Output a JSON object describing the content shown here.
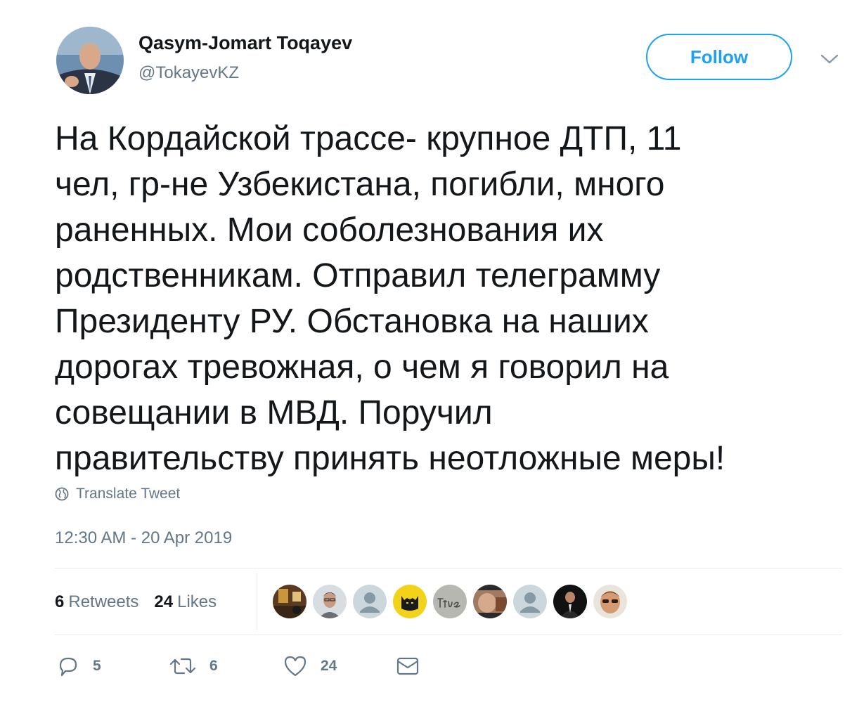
{
  "author": {
    "name": "Qasym-Jomart Toqayev",
    "handle": "@TokayevKZ"
  },
  "follow_button": {
    "label": "Follow"
  },
  "tweet": {
    "lines": [
      "На Кордайской трассе- крупное ДТП, 11",
      "чел, гр-не Узбекистана, погибли, много",
      "раненных. Мои соболезнования их",
      "родственникам. Отправил телеграмму",
      "Президенту РУ. Обстановка на наших",
      "дорогах тревожная, о чем я говорил на",
      "совещании в МВД. Поручил",
      "правительству принять неотложные меры!"
    ]
  },
  "translate": {
    "label": "Translate Tweet"
  },
  "timestamp": "12:30 AM - 20 Apr 2019",
  "stats": {
    "retweets": {
      "count": "6",
      "label": "Retweets"
    },
    "likes": {
      "count": "24",
      "label": "Likes"
    }
  },
  "likers": [
    {
      "icon": "avatar-photo-room"
    },
    {
      "icon": "avatar-photo-man-glasses"
    },
    {
      "icon": "avatar-default-gray"
    },
    {
      "icon": "avatar-batman-yellow"
    },
    {
      "icon": "avatar-handwriting-true",
      "text": "true"
    },
    {
      "icon": "avatar-meme-photo"
    },
    {
      "icon": "avatar-default-gray"
    },
    {
      "icon": "avatar-man-suit-dark"
    },
    {
      "icon": "avatar-man-sunglasses"
    }
  ],
  "actions": {
    "reply_count": "5",
    "retweet_count": "6",
    "like_count": "24"
  },
  "colors": {
    "accent": "#1da1f2",
    "text": "#14171a",
    "secondary": "#657786",
    "border": "#e6ecf0"
  }
}
